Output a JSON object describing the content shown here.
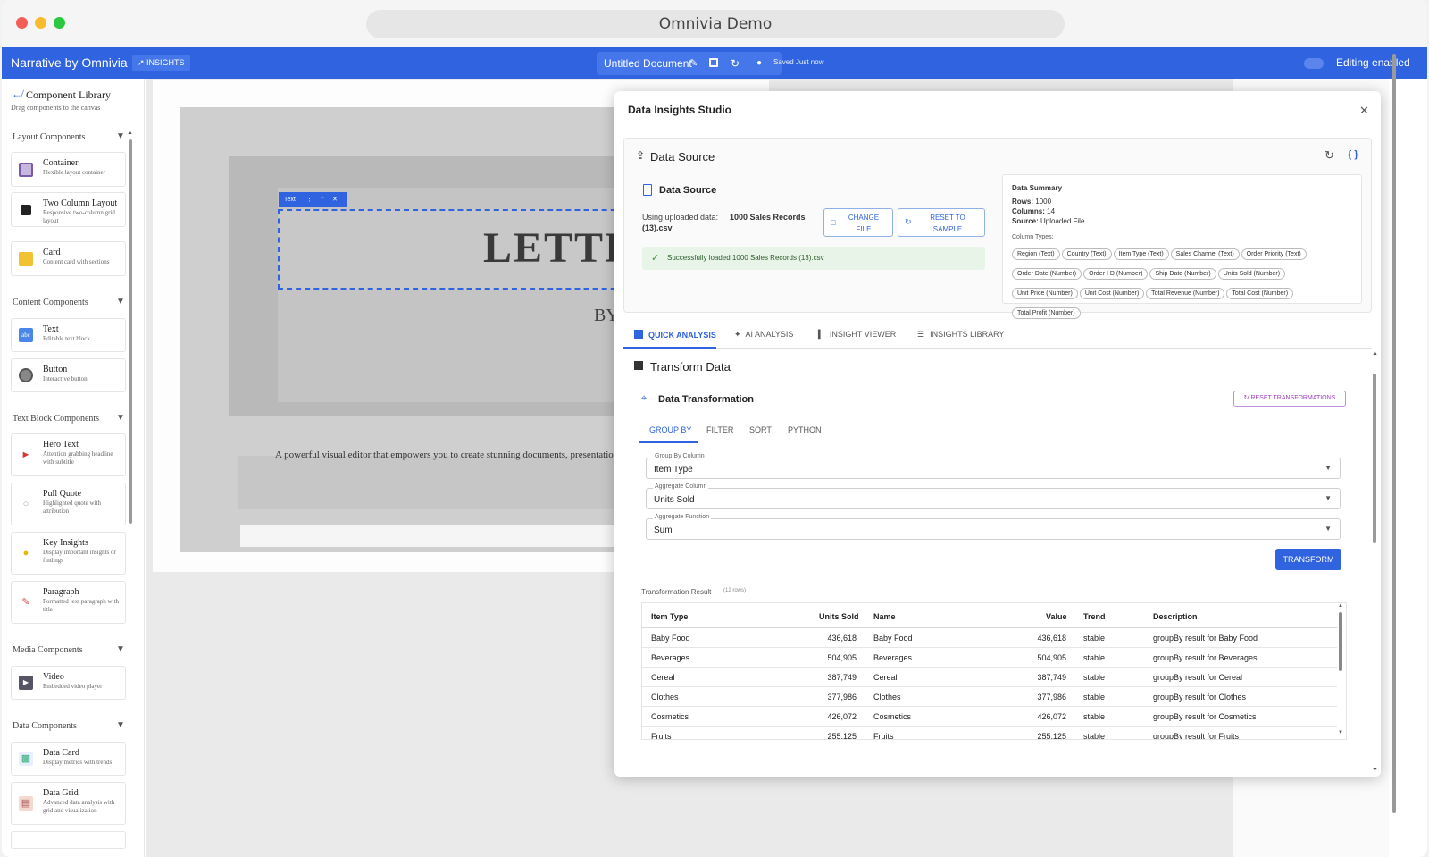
{
  "browser": {
    "title": "Omnivia Demo",
    "colors": {
      "close": "#f25f57",
      "minimize": "#f8bb2e",
      "zoom": "#2ac840"
    }
  },
  "appbar": {
    "brand": "Narrative by Omnivia",
    "insights_badge": "INSIGHTS",
    "doc_title": "Untitled Document",
    "saved_text": "Saved Just now",
    "editing_label": "Editing enabled",
    "accent": "#2f63e0"
  },
  "sidebar": {
    "title": "Component Library",
    "subtitle": "Drag components to the canvas",
    "sections": {
      "layout": "Layout Components",
      "content": "Content Components",
      "textblock": "Text Block Components",
      "media": "Media Components",
      "data": "Data Components"
    },
    "items": [
      {
        "name": "Container",
        "desc": "Flexible layout container",
        "icon": "container-icon"
      },
      {
        "name": "Two Column Layout",
        "desc": "Responsive two-column grid layout",
        "icon": "two-column-icon"
      },
      {
        "name": "Card",
        "desc": "Content card with sections",
        "icon": "card-icon"
      },
      {
        "name": "Text",
        "desc": "Editable text block",
        "icon": "text-icon"
      },
      {
        "name": "Button",
        "desc": "Interactive button",
        "icon": "button-icon"
      },
      {
        "name": "Hero Text",
        "desc": "Attention grabbing headline with subtitle",
        "icon": "megaphone-icon"
      },
      {
        "name": "Pull Quote",
        "desc": "Highlighted quote with attribution",
        "icon": "speech-bubble-icon"
      },
      {
        "name": "Key Insights",
        "desc": "Display important insights or findings",
        "icon": "lightbulb-icon"
      },
      {
        "name": "Paragraph",
        "desc": "Formatted text paragraph with title",
        "icon": "paragraph-icon"
      },
      {
        "name": "Video",
        "desc": "Embedded video player",
        "icon": "clapper-icon"
      },
      {
        "name": "Data Card",
        "desc": "Display metrics with trends",
        "icon": "bar-chart-icon"
      },
      {
        "name": "Data Grid",
        "desc": "Advanced data analysis with grid and visualization",
        "icon": "clipboard-icon"
      }
    ]
  },
  "canvas": {
    "selected_tag": "Text",
    "letter_text": "LETTE",
    "by_text": "BY",
    "body_text": "A powerful visual editor that empowers you to create stunning documents, presentation"
  },
  "modal": {
    "title": "Data Insights Studio",
    "data_source": {
      "heading": "Data Source",
      "sub_heading": "Data Source",
      "using_text": "Using uploaded data:",
      "file_name": "1000 Sales Records (13).csv",
      "change_file": "CHANGE FILE",
      "reset_sample": "RESET TO SAMPLE",
      "success": "Successfully loaded 1000 Sales Records (13).csv",
      "summary_title": "Data Summary",
      "rows_label": "Rows:",
      "rows": "1000",
      "cols_label": "Columns:",
      "cols": "14",
      "src_label": "Source:",
      "src": "Uploaded File",
      "coltypes_label": "Column Types:",
      "column_types": [
        "Region (Text)",
        "Country (Text)",
        "Item Type (Text)",
        "Sales Channel (Text)",
        "Order Priority (Text)",
        "Order Date (Number)",
        "Order I D (Number)",
        "Ship Date (Number)",
        "Units Sold (Number)",
        "Unit Price (Number)",
        "Unit Cost (Number)",
        "Total Revenue (Number)",
        "Total Cost (Number)",
        "Total Profit (Number)"
      ]
    },
    "tabs": [
      "QUICK ANALYSIS",
      "AI ANALYSIS",
      "INSIGHT VIEWER",
      "INSIGHTS LIBRARY"
    ],
    "transform": {
      "heading": "Transform Data",
      "sub_heading": "Data Transformation",
      "reset": "RESET TRANSFORMATIONS",
      "subtabs": [
        "GROUP BY",
        "FILTER",
        "SORT",
        "PYTHON"
      ],
      "group_label": "Group By Column",
      "group_value": "Item Type",
      "agg_col_label": "Aggregate Column",
      "agg_col_value": "Units Sold",
      "agg_fn_label": "Aggregate Function",
      "agg_fn_value": "Sum",
      "button": "TRANSFORM",
      "result_label": "Transformation Result",
      "result_count": "(12 rows)",
      "columns": [
        "Item Type",
        "Units Sold",
        "Name",
        "Value",
        "Trend",
        "Description"
      ],
      "rows": [
        [
          "Baby Food",
          "436,618",
          "Baby Food",
          "436,618",
          "stable",
          "groupBy result for Baby Food"
        ],
        [
          "Beverages",
          "504,905",
          "Beverages",
          "504,905",
          "stable",
          "groupBy result for Beverages"
        ],
        [
          "Cereal",
          "387,749",
          "Cereal",
          "387,749",
          "stable",
          "groupBy result for Cereal"
        ],
        [
          "Clothes",
          "377,986",
          "Clothes",
          "377,986",
          "stable",
          "groupBy result for Clothes"
        ],
        [
          "Cosmetics",
          "426,072",
          "Cosmetics",
          "426,072",
          "stable",
          "groupBy result for Cosmetics"
        ],
        [
          "Fruits",
          "255,125",
          "Fruits",
          "255,125",
          "stable",
          "groupBy result for Fruits"
        ]
      ]
    }
  }
}
